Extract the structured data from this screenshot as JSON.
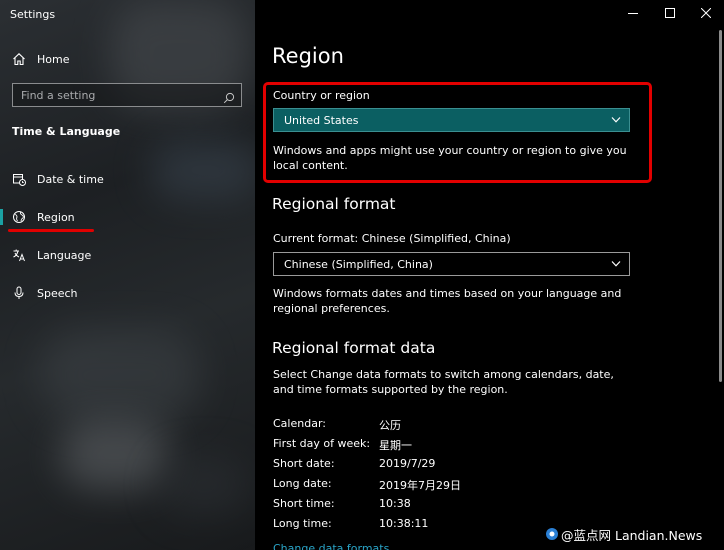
{
  "window": {
    "app_title": "Settings"
  },
  "sidebar": {
    "home_label": "Home",
    "search_placeholder": "Find a setting",
    "section_heading": "Time & Language",
    "items": [
      {
        "label": "Date & time",
        "icon": "calendar-clock-icon"
      },
      {
        "label": "Region",
        "icon": "globe-icon",
        "active": true
      },
      {
        "label": "Language",
        "icon": "language-icon"
      },
      {
        "label": "Speech",
        "icon": "microphone-icon"
      }
    ]
  },
  "main": {
    "page_title": "Region",
    "country": {
      "label": "Country or region",
      "selected": "United States",
      "description": "Windows and apps might use your country or region to give you local content."
    },
    "regional_format": {
      "heading": "Regional format",
      "current_label": "Current format: Chinese (Simplified, China)",
      "selected": "Chinese (Simplified, China)",
      "description": "Windows formats dates and times based on your language and regional preferences."
    },
    "format_data": {
      "heading": "Regional format data",
      "description": "Select Change data formats to switch among calendars, date, and time formats supported by the region.",
      "rows": [
        {
          "label": "Calendar:",
          "value": "公历"
        },
        {
          "label": "First day of week:",
          "value": "星期一"
        },
        {
          "label": "Short date:",
          "value": "2019/7/29"
        },
        {
          "label": "Long date:",
          "value": "2019年7月29日"
        },
        {
          "label": "Short time:",
          "value": "10:38"
        },
        {
          "label": "Long time:",
          "value": "10:38:11"
        }
      ],
      "change_link": "Change data formats"
    }
  },
  "watermark": {
    "text": "@蓝点网 Landian.News"
  },
  "colors": {
    "accent": "#0b5f62",
    "highlight": "#e20000",
    "link": "#2aa5c8"
  }
}
